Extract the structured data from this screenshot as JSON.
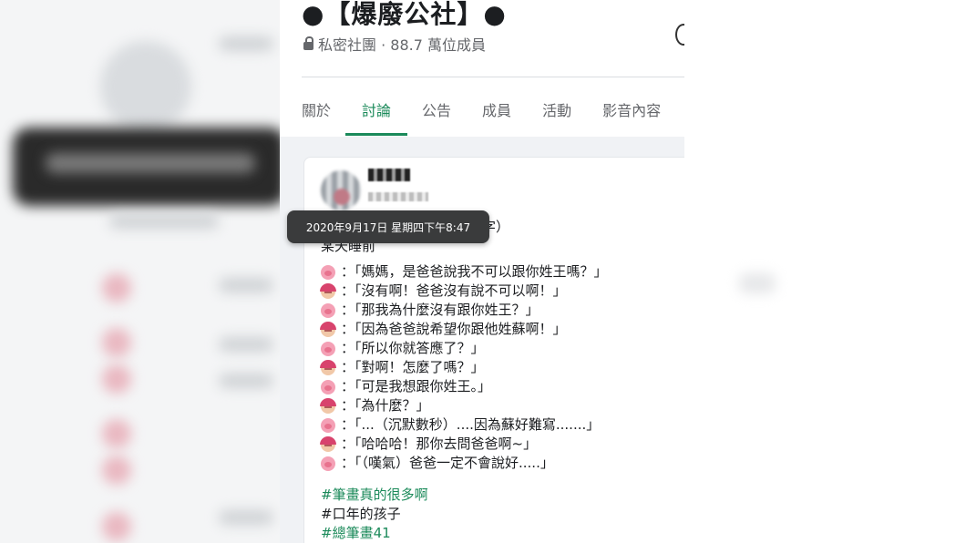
{
  "group": {
    "title": "●【爆廢公社】●",
    "privacy_label": "私密社團 · 88.7 萬位成員"
  },
  "tabs": [
    {
      "label": "關於",
      "active": false
    },
    {
      "label": "討論",
      "active": true
    },
    {
      "label": "公告",
      "active": false
    },
    {
      "label": "成員",
      "active": false
    },
    {
      "label": "活動",
      "active": false
    },
    {
      "label": "影音內容",
      "active": false
    }
  ],
  "post": {
    "timestamp_tooltip": "2020年9月17日 星期四下午8:47",
    "header_tail": "字）",
    "intro": "某天睡前",
    "lines": [
      {
        "speaker": "pig-face",
        "text": "：「媽媽，是爸爸說我不可以跟你姓王嗎？」"
      },
      {
        "speaker": "woman-face",
        "text": "：「沒有啊！爸爸沒有說不可以啊！」"
      },
      {
        "speaker": "pig-face",
        "text": "：「那我為什麼沒有跟你姓王？」"
      },
      {
        "speaker": "woman-face",
        "text": "：「因為爸爸說希望你跟他姓蘇啊！」"
      },
      {
        "speaker": "pig-face",
        "text": "：「所以你就答應了？」"
      },
      {
        "speaker": "woman-face",
        "text": "：「對啊！怎麼了嗎？」"
      },
      {
        "speaker": "pig-face",
        "text": "：「可是我想跟你姓王。」"
      },
      {
        "speaker": "woman-face",
        "text": "：「為什麼？」"
      },
      {
        "speaker": "pig-face",
        "text": "：「...（沉默數秒）....因為蘇好難寫.......」"
      },
      {
        "speaker": "woman-face",
        "text": "：「哈哈哈！那你去問爸爸啊~」"
      },
      {
        "speaker": "pig-face",
        "text": "：「（嘆氣）爸爸一定不會說好.....」"
      }
    ],
    "hashtags": [
      "#筆畫真的很多啊",
      "#口年的孩子",
      "#總筆畫41"
    ]
  },
  "colors": {
    "accent": "#1b8a5a",
    "tooltip_bg": "#3a3b3c"
  }
}
